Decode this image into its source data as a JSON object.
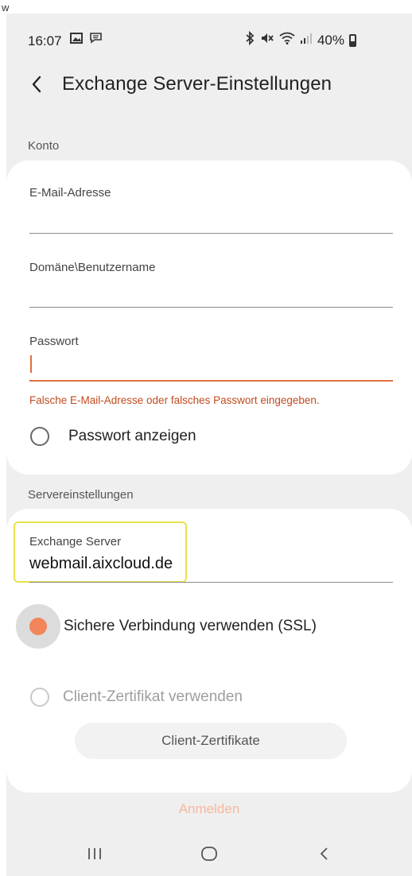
{
  "page_mark": "w",
  "status_bar": {
    "time": "16:07",
    "battery_text": "40%",
    "icons_left": [
      "image-icon",
      "message-icon"
    ],
    "icons_right": [
      "bluetooth-icon",
      "mute-icon",
      "wifi-icon",
      "signal-icon",
      "battery-icon"
    ]
  },
  "header": {
    "title": "Exchange Server-Einstellungen",
    "back_icon": "chevron-left-icon"
  },
  "account_section": {
    "label": "Konto",
    "email": {
      "label": "E-Mail-Adresse",
      "value": ""
    },
    "domain_user": {
      "label": "Domäne\\Benutzername",
      "value": ""
    },
    "password": {
      "label": "Passwort",
      "value": ""
    },
    "error": "Falsche E-Mail-Adresse oder falsches Passwort eingegeben.",
    "show_password": {
      "label": "Passwort anzeigen",
      "checked": false
    }
  },
  "server_section": {
    "label": "Servereinstellungen",
    "exchange_server": {
      "label": "Exchange Server",
      "value": "webmail.aixcloud.de"
    },
    "ssl": {
      "label": "Sichere Verbindung verwenden (SSL)",
      "checked": true
    },
    "client_cert": {
      "label": "Client-Zertifikat verwenden",
      "checked": false,
      "enabled": false
    },
    "cert_button": "Client-Zertifikate"
  },
  "signin_button": "Anmelden",
  "nav_bar": {
    "items": [
      "recent-apps-icon",
      "home-icon",
      "back-icon"
    ]
  },
  "colors": {
    "accent": "#f2855a",
    "error": "#c24a1e",
    "highlight": "#e9e24a",
    "background": "#efefef"
  }
}
